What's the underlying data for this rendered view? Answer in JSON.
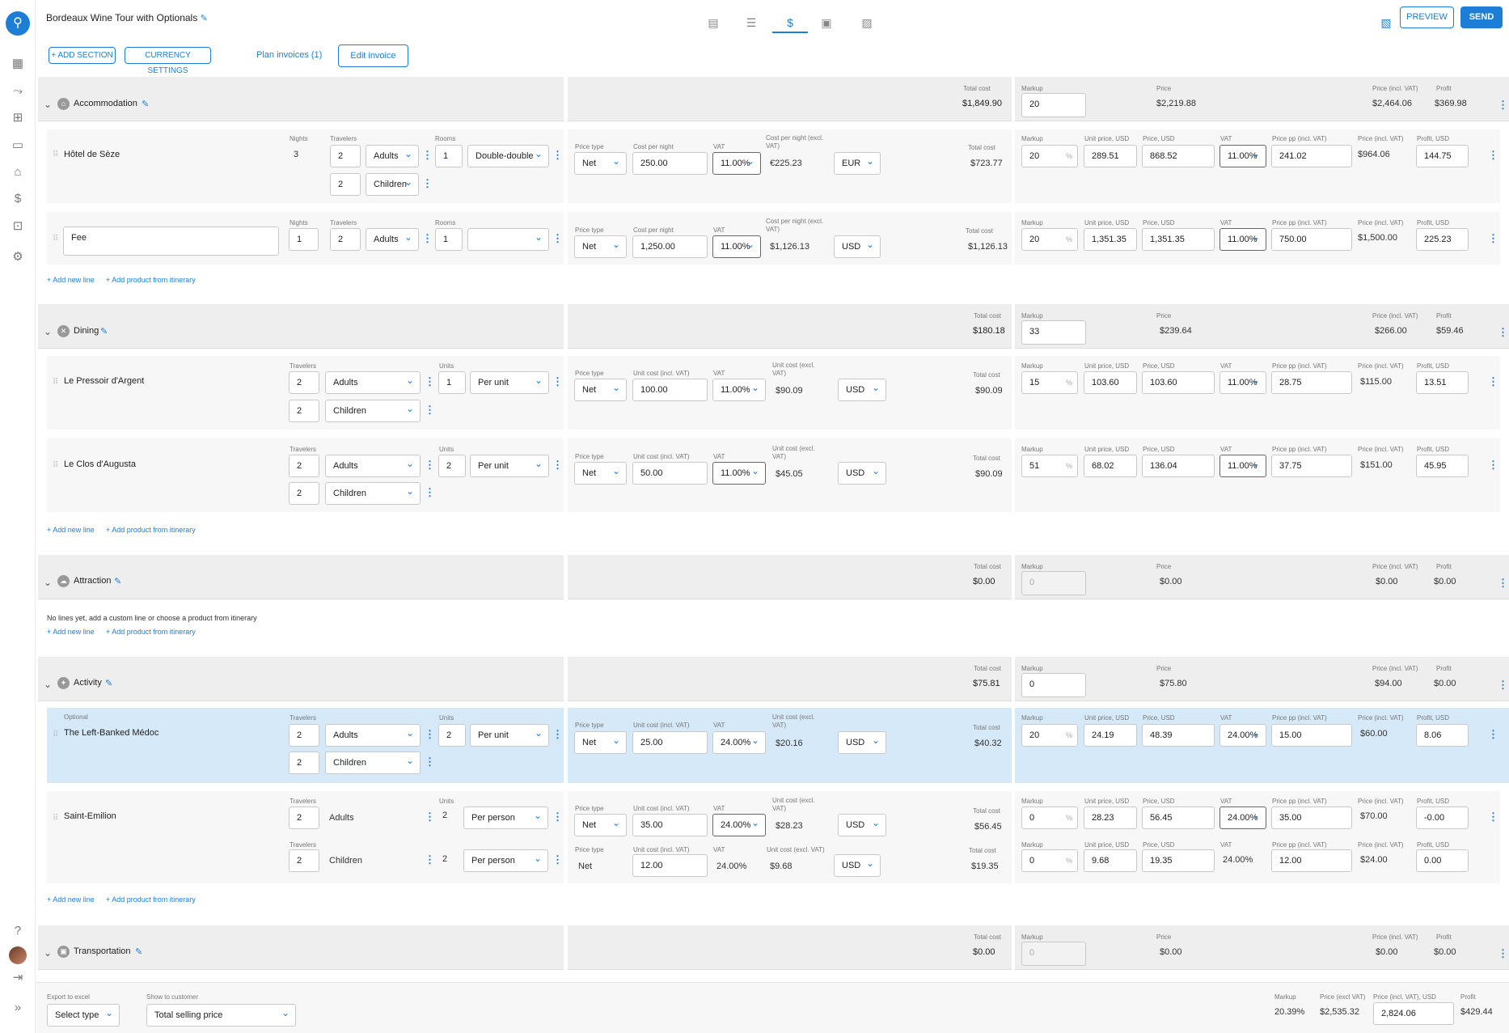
{
  "app": {
    "title": "Bordeaux Wine Tour with Optionals"
  },
  "toolbar": {
    "add_section": "+ ADD SECTION",
    "currency_settings": "CURRENCY SETTINGS",
    "plan_invoices": "Plan invoices (1)",
    "edit_invoice": "Edit invoice",
    "preview": "PREVIEW",
    "send": "SEND"
  },
  "labels": {
    "total_cost": "Total cost",
    "markup": "Markup",
    "price": "Price",
    "price_incl": "Price (incl. VAT)",
    "profit": "Profit",
    "nights": "Nights",
    "travelers": "Travelers",
    "rooms": "Rooms",
    "units": "Units",
    "price_type": "Price type",
    "cost_per_night": "Cost per night",
    "vat": "VAT",
    "cost_per_night_excl": "Cost per night (excl. VAT)",
    "unit_cost_incl": "Unit cost (incl. VAT)",
    "unit_cost_excl": "Unit cost (excl. VAT)",
    "unit_price_usd": "Unit price, USD",
    "price_usd": "Price, USD",
    "price_pp_incl": "Price pp (incl. VAT)",
    "profit_usd": "Profit, USD",
    "add_new_line": "+ Add new line",
    "add_product": "+ Add product from itinerary",
    "optional": "Optional",
    "no_lines": "No lines yet, add a custom line or choose a product from itinerary",
    "pct": "%"
  },
  "sections": {
    "accommodation": {
      "name": "Accommodation",
      "total_cost": "$1,849.90",
      "markup": "20",
      "price": "$2,219.88",
      "price_incl": "$2,464.06",
      "profit": "$369.98"
    },
    "dining": {
      "name": "Dining",
      "total_cost": "$180.18",
      "markup": "33",
      "price": "$239.64",
      "price_incl": "$266.00",
      "profit": "$59.46"
    },
    "attraction": {
      "name": "Attraction",
      "total_cost": "$0.00",
      "markup": "0",
      "price": "$0.00",
      "price_incl": "$0.00",
      "profit": "$0.00"
    },
    "activity": {
      "name": "Activity",
      "total_cost": "$75.81",
      "markup": "0",
      "price": "$75.80",
      "price_incl": "$94.00",
      "profit": "$0.00"
    },
    "transportation": {
      "name": "Transportation",
      "total_cost": "$0.00",
      "markup": "0",
      "price": "$0.00",
      "price_incl": "$0.00",
      "profit": "$0.00"
    }
  },
  "rows": {
    "hotel": {
      "name": "Hôtel de Sèze",
      "nights": "3",
      "trav_adults": "2",
      "adults": "Adults",
      "trav_children": "2",
      "children": "Children",
      "rooms": "1",
      "room_type": "Double-double",
      "price_type": "Net",
      "cost": "250.00",
      "vat": "11.00%",
      "cost_excl": "€225.23",
      "currency": "EUR",
      "total_cost": "$723.77",
      "markup": "20",
      "unit_price": "289.51",
      "price": "868.52",
      "vat2": "11.00%",
      "price_pp": "241.02",
      "price_incl": "$964.06",
      "profit": "144.75"
    },
    "fee": {
      "name": "Fee",
      "nights": "1",
      "trav_adults": "2",
      "adults": "Adults",
      "rooms": "1",
      "price_type": "Net",
      "cost": "1,250.00",
      "vat": "11.00%",
      "cost_excl": "$1,126.13",
      "currency": "USD",
      "total_cost": "$1,126.13",
      "markup": "20",
      "unit_price": "1,351.35",
      "price": "1,351.35",
      "vat2": "11.00%",
      "price_pp": "750.00",
      "price_incl": "$1,500.00",
      "profit": "225.23"
    },
    "pressoir": {
      "name": "Le Pressoir d'Argent",
      "trav_adults": "2",
      "adults": "Adults",
      "trav_children": "2",
      "children": "Children",
      "units": "1",
      "unit_type": "Per unit",
      "price_type": "Net",
      "cost": "100.00",
      "vat": "11.00%",
      "cost_excl": "$90.09",
      "currency": "USD",
      "total_cost": "$90.09",
      "markup": "15",
      "unit_price": "103.60",
      "price": "103.60",
      "vat2": "11.00%",
      "price_pp": "28.75",
      "price_incl": "$115.00",
      "profit": "13.51"
    },
    "clos": {
      "name": "Le Clos d'Augusta",
      "trav_adults": "2",
      "adults": "Adults",
      "trav_children": "2",
      "children": "Children",
      "units": "2",
      "unit_type": "Per unit",
      "price_type": "Net",
      "cost": "50.00",
      "vat": "11.00%",
      "cost_excl": "$45.05",
      "currency": "USD",
      "total_cost": "$90.09",
      "markup": "51",
      "unit_price": "68.02",
      "price": "136.04",
      "vat2": "11.00%",
      "price_pp": "37.75",
      "price_incl": "$151.00",
      "profit": "45.95"
    },
    "medoc": {
      "name": "The Left-Banked Médoc",
      "trav_adults": "2",
      "adults": "Adults",
      "trav_children": "2",
      "children": "Children",
      "units": "2",
      "unit_type": "Per unit",
      "price_type": "Net",
      "cost": "25.00",
      "vat": "24.00%",
      "cost_excl": "$20.16",
      "currency": "USD",
      "total_cost": "$40.32",
      "markup": "20",
      "unit_price": "24.19",
      "price": "48.39",
      "vat2": "24.00%",
      "price_pp": "15.00",
      "price_incl": "$60.00",
      "profit": "8.06"
    },
    "emilion": {
      "name": "Saint-Emilion",
      "trav_adults": "2",
      "adults": "Adults",
      "units_a": "2",
      "unit_type_a": "Per person",
      "price_type": "Net",
      "cost": "35.00",
      "vat": "24.00%",
      "cost_excl": "$28.23",
      "currency": "USD",
      "total_cost": "$56.45",
      "markup": "0",
      "unit_price": "28.23",
      "price": "56.45",
      "vat2": "24.00%",
      "price_pp": "35.00",
      "price_incl": "$70.00",
      "profit": "-0.00",
      "trav_children": "2",
      "children": "Children",
      "units_c": "2",
      "unit_type_c": "Per person",
      "price_type_c": "Net",
      "cost_c": "12.00",
      "vat_c": "24.00%",
      "cost_excl_c": "$9.68",
      "currency_c": "USD",
      "total_cost_c": "$19.35",
      "markup_c": "0",
      "unit_price_c": "9.68",
      "price_c": "19.35",
      "vat2_c": "24.00%",
      "price_pp_c": "12.00",
      "price_incl_c": "$24.00",
      "profit_c": "0.00"
    }
  },
  "footer": {
    "export_label": "Export to excel",
    "export_value": "Select type",
    "show_label": "Show to customer",
    "show_value": "Total selling price",
    "markup_label": "Markup",
    "markup": "20.39%",
    "price_excl_label": "Price (excl VAT)",
    "price_excl": "$2,535.32",
    "price_incl_label": "Price (incl. VAT), USD",
    "price_incl": "2,824.06",
    "profit_label": "Profit",
    "profit": "$429.44"
  },
  "colors": {
    "accent": "#1c7ed6",
    "highlight": "#d6e9f8"
  },
  "icons": [
    "location-pin-icon",
    "dashboard-icon",
    "route-icon",
    "hierarchy-icon",
    "contact-card-icon",
    "hotel-icon",
    "dollar-icon",
    "widgets-icon",
    "gear-icon",
    "help-icon",
    "logout-icon",
    "expand-icon",
    "calendar-icon",
    "list-icon",
    "invoice-icon",
    "document-icon",
    "image-icon",
    "map-icon"
  ]
}
